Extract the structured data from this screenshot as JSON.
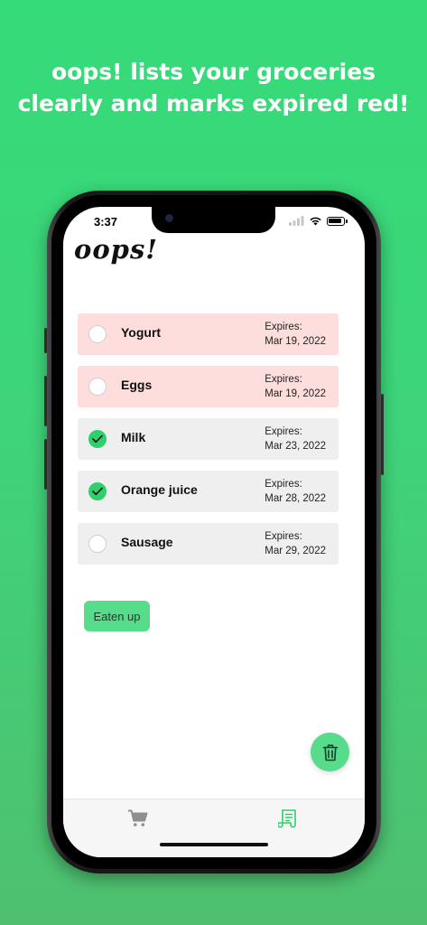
{
  "headline": {
    "line1": "oops! lists your groceries",
    "line2": "clearly and marks expired red!"
  },
  "status_bar": {
    "time": "3:37"
  },
  "app": {
    "title": "oops!"
  },
  "expires_label": "Expires:",
  "items": [
    {
      "name": "Yogurt",
      "expires": "Mar 19, 2022",
      "expired": true,
      "checked": false
    },
    {
      "name": "Eggs",
      "expires": "Mar 19, 2022",
      "expired": true,
      "checked": false
    },
    {
      "name": "Milk",
      "expires": "Mar 23, 2022",
      "expired": false,
      "checked": true
    },
    {
      "name": "Orange juice",
      "expires": "Mar 28, 2022",
      "expired": false,
      "checked": true
    },
    {
      "name": "Sausage",
      "expires": "Mar 29, 2022",
      "expired": false,
      "checked": false
    }
  ],
  "eaten_button": {
    "label": "Eaten up"
  },
  "fab": {
    "icon": "trash-icon"
  },
  "tabs": [
    {
      "icon": "cart-icon",
      "active": false
    },
    {
      "icon": "receipt-icon",
      "active": true
    }
  ],
  "colors": {
    "accent": "#57dc8c",
    "check_on": "#2fcf6c",
    "expired_row": "#fddedd",
    "normal_row": "#efefef",
    "tab_active": "#2fcf6c",
    "tab_inactive": "#8e8e8e"
  }
}
